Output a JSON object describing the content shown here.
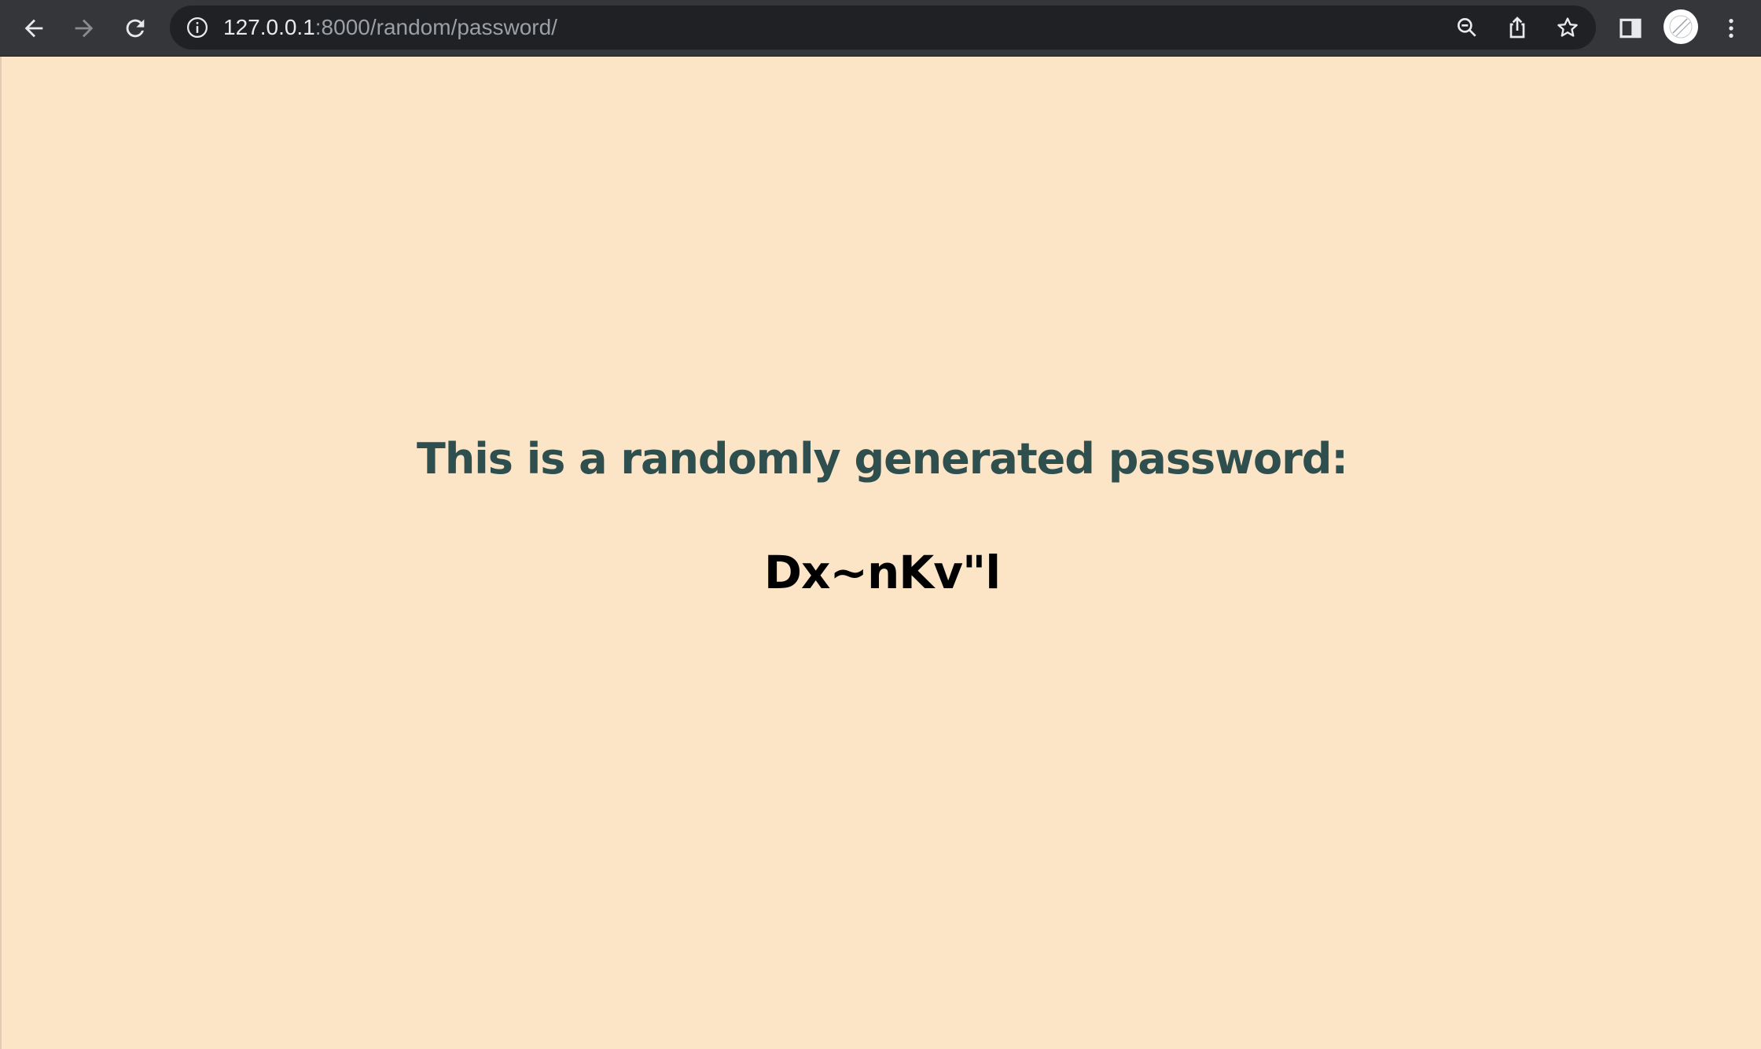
{
  "browser": {
    "url_host": "127.0.0.1",
    "url_path": ":8000/random/password/",
    "icons": {
      "back": "back-arrow-icon",
      "forward": "forward-arrow-icon",
      "reload": "reload-icon",
      "site_info": "info-icon",
      "zoom": "zoom-icon",
      "share": "share-icon",
      "bookmark": "star-icon",
      "side_panel": "side-panel-icon",
      "profile": "avatar",
      "menu": "kebab-menu-icon"
    },
    "colors": {
      "toolbar_bg": "#35363a",
      "omnibox_bg": "#202124"
    }
  },
  "page": {
    "heading": "This is a randomly generated password:",
    "password": "Dx~nKv\"l",
    "colors": {
      "background": "#fce4c7",
      "heading": "#2f4f4f",
      "password": "#000000"
    }
  }
}
